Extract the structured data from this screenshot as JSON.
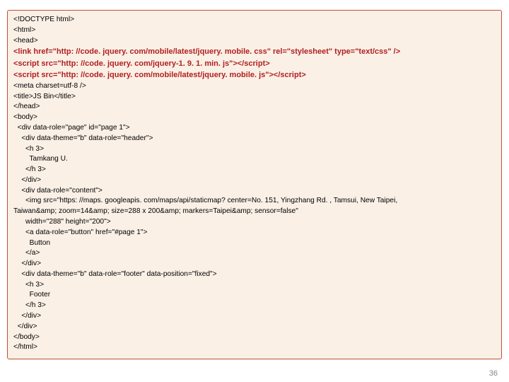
{
  "code": {
    "l1": "<!DOCTYPE html>",
    "l2": "<html>",
    "l3": "<head>",
    "b1": "<link href=\"http: //code. jquery. com/mobile/latest/jquery. mobile. css\" rel=\"stylesheet\" type=\"text/css\" />",
    "b2": "<script src=\"http: //code. jquery. com/jquery-1. 9. 1. min. js\"></script>",
    "b3": "<script src=\"http: //code. jquery. com/mobile/latest/jquery. mobile. js\"></script>",
    "l4": "<meta charset=utf-8 />",
    "l5": "<title>JS Bin</title>",
    "l6": "</head>",
    "l7": "<body>",
    "l8": "  <div data-role=\"page\" id=\"page 1\">",
    "l9": "    <div data-theme=\"b\" data-role=\"header\">",
    "l10": "      <h 3>",
    "l11": "        Tamkang U.",
    "l12": "      </h 3>",
    "l13": "    </div>",
    "l14": "    <div data-role=\"content\">",
    "l15": "      <img src=\"https: //maps. googleapis. com/maps/api/staticmap? center=No. 151, Yingzhang Rd. , Tamsui, New Taipei,",
    "l15b": "Taiwan&amp; zoom=14&amp; size=288 x 200&amp; markers=Taipei&amp; sensor=false\"",
    "l16": "      width=\"288\" height=\"200\">",
    "l17": "      <a data-role=\"button\" href=\"#page 1\">",
    "l18": "        Button",
    "l19": "      </a>",
    "l20": "    </div>",
    "l21": "    <div data-theme=\"b\" data-role=\"footer\" data-position=\"fixed\">",
    "l22": "      <h 3>",
    "l23": "        Footer",
    "l24": "      </h 3>",
    "l25": "    </div>",
    "l26": "  </div>",
    "l27": "</body>",
    "l28": "</html>"
  },
  "slideNumber": "36"
}
